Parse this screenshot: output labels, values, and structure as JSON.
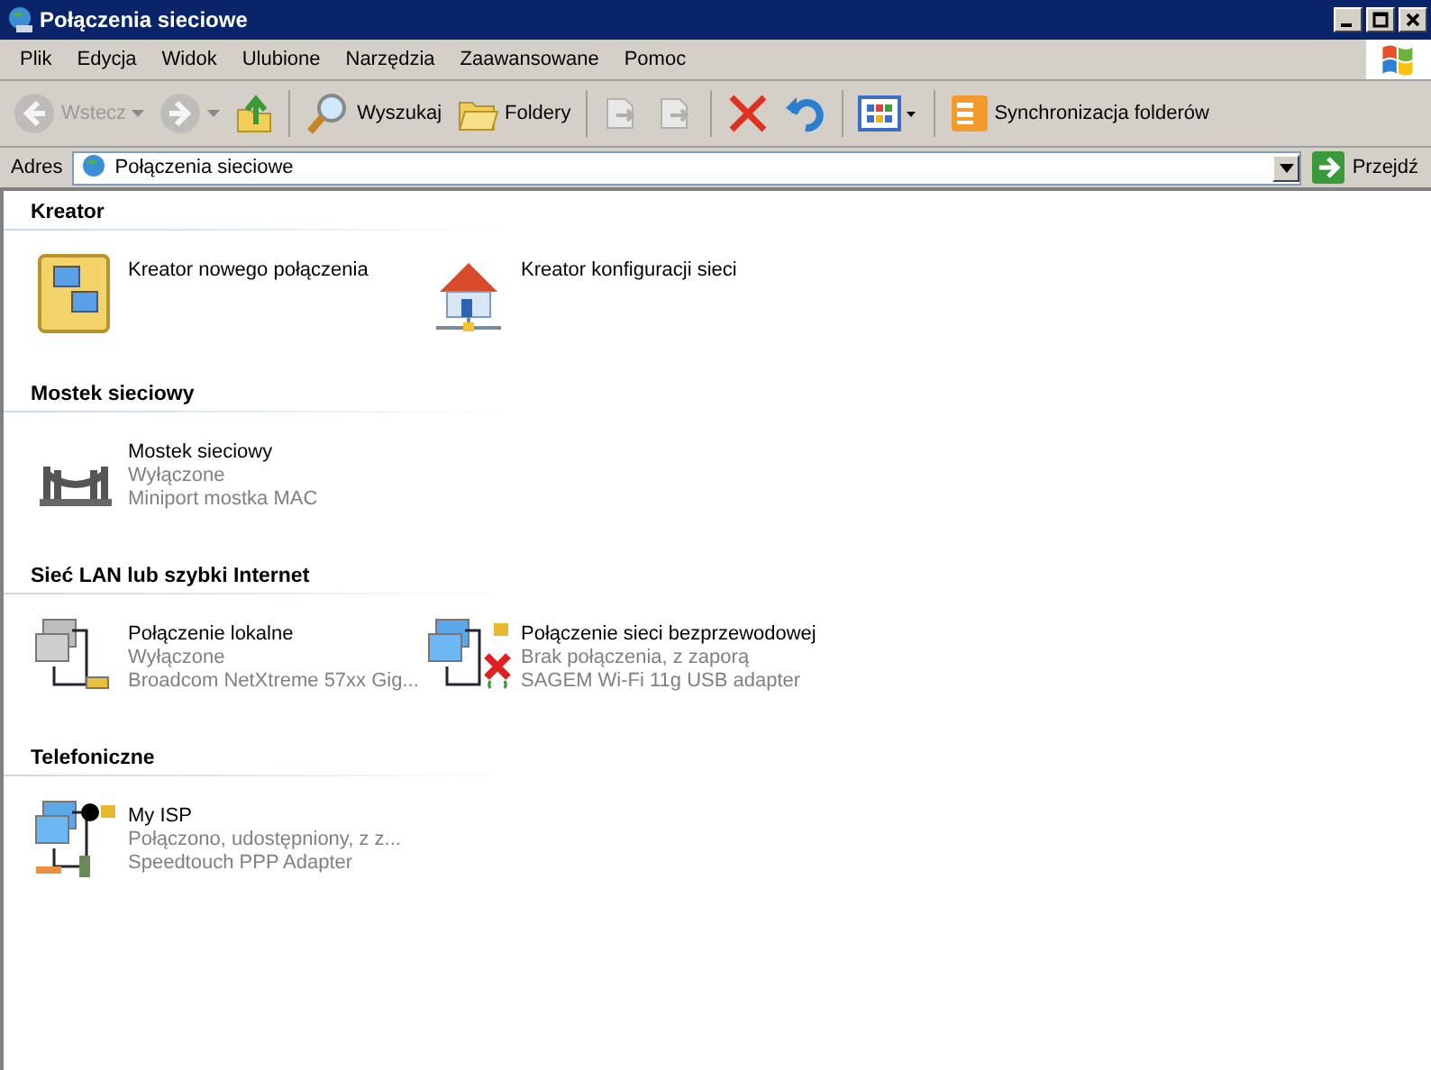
{
  "window": {
    "title": "Połączenia sieciowe"
  },
  "menu": [
    "Plik",
    "Edycja",
    "Widok",
    "Ulubione",
    "Narzędzia",
    "Zaawansowane",
    "Pomoc"
  ],
  "toolbar": [
    {
      "kind": "back",
      "label": "Wstecz",
      "disabled": true
    },
    {
      "kind": "forward",
      "disabled": true
    },
    {
      "kind": "up",
      "disabled": false
    },
    {
      "kind": "search",
      "label": "Wyszukaj",
      "disabled": false
    },
    {
      "kind": "folders",
      "label": "Foldery",
      "disabled": false
    },
    {
      "kind": "move",
      "disabled": true
    },
    {
      "kind": "copy",
      "disabled": true
    },
    {
      "kind": "delete",
      "disabled": false
    },
    {
      "kind": "undo",
      "disabled": false
    },
    {
      "kind": "views",
      "disabled": false
    },
    {
      "kind": "sync",
      "label": "Synchronizacja folderów",
      "disabled": false
    }
  ],
  "address": {
    "label": "Adres",
    "value": "Połączenia sieciowe",
    "go": "Przejdź"
  },
  "groups": [
    {
      "title": "Kreator",
      "items": [
        {
          "kind": "wizard",
          "name": "Kreator nowego połączenia"
        },
        {
          "kind": "home",
          "name": "Kreator konfiguracji sieci"
        }
      ]
    },
    {
      "title": "Mostek sieciowy",
      "items": [
        {
          "kind": "bridge",
          "name": "Mostek sieciowy",
          "status": "Wyłączone",
          "device": "Miniport mostka MAC"
        }
      ]
    },
    {
      "title": "Sieć LAN lub szybki Internet",
      "items": [
        {
          "kind": "lan",
          "name": "Połączenie lokalne",
          "status": "Wyłączone",
          "device": "Broadcom NetXtreme 57xx Gig..."
        },
        {
          "kind": "wifi",
          "name": "Połączenie sieci bezprzewodowej",
          "status": "Brak połączenia, z zaporą",
          "device": "SAGEM Wi-Fi 11g USB adapter"
        }
      ]
    },
    {
      "title": "Telefoniczne",
      "items": [
        {
          "kind": "dialup",
          "name": "My ISP",
          "status": "Połączono, udostępniony, z z...",
          "device": "Speedtouch PPP Adapter"
        }
      ]
    }
  ]
}
